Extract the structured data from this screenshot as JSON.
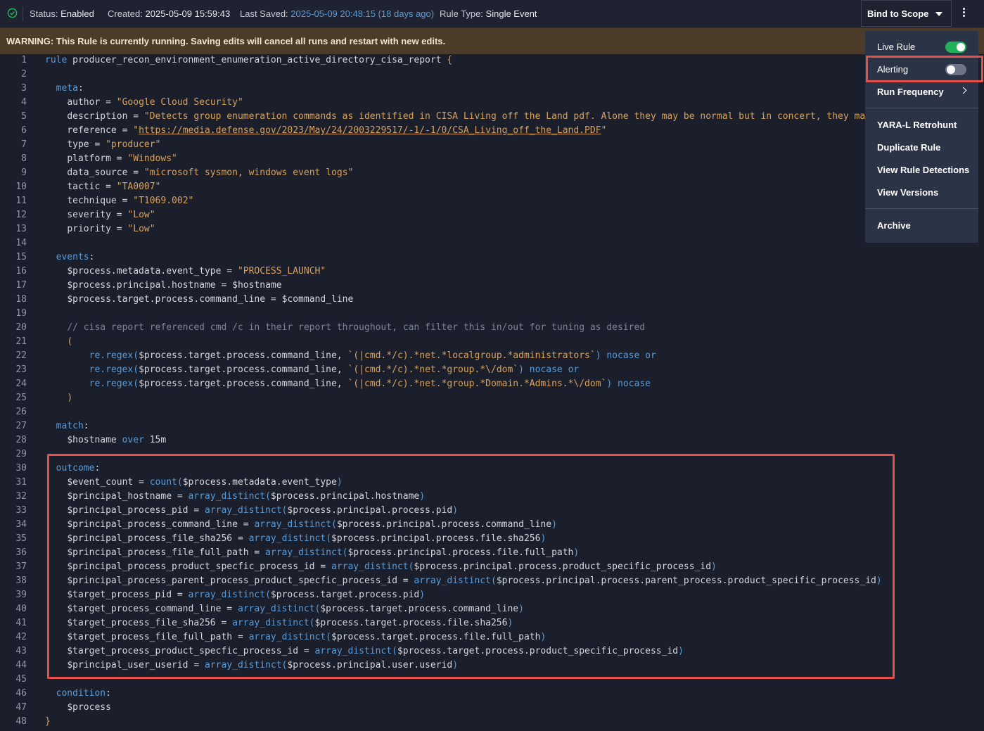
{
  "status_bar": {
    "status_label": "Status:",
    "status_value": "Enabled",
    "created_label": "Created:",
    "created_value": "2025-05-09 15:59:43",
    "saved_label": "Last Saved:",
    "saved_value": "2025-05-09 20:48:15 (18 days ago)",
    "type_label": "Rule Type:",
    "type_value": "Single Event",
    "bind_button": "Bind to Scope"
  },
  "warning": "WARNING: This Rule is currently running. Saving edits will cancel all runs and restart with new edits.",
  "menu": {
    "live_rule": "Live Rule",
    "live_rule_on": true,
    "alerting": "Alerting",
    "alerting_on": false,
    "run_frequency": "Run Frequency",
    "retrohunt": "YARA-L Retrohunt",
    "duplicate": "Duplicate Rule",
    "detections": "View Rule Detections",
    "versions": "View Versions",
    "archive": "Archive"
  },
  "colors": {
    "keyword": "#5b9bd6",
    "string": "#d7a15c",
    "comment": "#7d8596",
    "highlight": "#e4504a",
    "toggle_on": "#20b15a"
  },
  "code": {
    "l1": "producer_recon_environment_enumeration_active_directory_cisa_report",
    "l3": "meta",
    "l4_key": "author",
    "l4_val": "\"Google Cloud Security\"",
    "l5_key": "description",
    "l5_val": "\"Detects group enumeration commands as identified in CISA Living off the Land pdf. Alone they may be normal but in concert, they may",
    "l6_key": "reference",
    "l6_url": "https://media.defense.gov/2023/May/24/2003229517/-1/-1/0/CSA_Living_off_the_Land.PDF",
    "l7_key": "type",
    "l7_val": "\"producer\"",
    "l8_key": "platform",
    "l8_val": "\"Windows\"",
    "l9_key": "data_source",
    "l9_val": "\"microsoft sysmon, windows event logs\"",
    "l10_key": "tactic",
    "l10_val": "\"TA0007\"",
    "l11_key": "technique",
    "l11_val": "\"T1069.002\"",
    "l12_key": "severity",
    "l12_val": "\"Low\"",
    "l13_key": "priority",
    "l13_val": "\"Low\"",
    "l15": "events",
    "l16_a": "$process.metadata.event_type",
    "l16_b": "\"PROCESS_LAUNCH\"",
    "l17_a": "$process.principal.hostname",
    "l17_b": "$hostname",
    "l18_a": "$process.target.process.command_line",
    "l18_b": "$command_line",
    "l20": "// cisa report referenced cmd /c in their report throughout, can filter this in/out for tuning as desired",
    "l22_arg": "$process.target.process.command_line, ",
    "l22_re": "`(|cmd.*/c).*net.*localgroup.*administrators`",
    "l23_re": "`(|cmd.*/c).*net.*group.*\\/dom`",
    "l24_re": "`(|cmd.*/c).*net.*group.*Domain.*Admins.*\\/dom`",
    "l27": "match",
    "l28_a": "$hostname",
    "l28_b": "15m",
    "l30": "outcome",
    "l31_a": "$event_count",
    "l31_b": "$process.metadata.event_type",
    "l32_a": "$principal_hostname",
    "l32_b": "$process.principal.hostname",
    "l33_a": "$principal_process_pid",
    "l33_b": "$process.principal.process.pid",
    "l34_a": "$principal_process_command_line",
    "l34_b": "$process.principal.process.command_line",
    "l35_a": "$principal_process_file_sha256",
    "l35_b": "$process.principal.process.file.sha256",
    "l36_a": "$principal_process_file_full_path",
    "l36_b": "$process.principal.process.file.full_path",
    "l37_a": "$principal_process_product_specfic_process_id",
    "l37_b": "$process.principal.process.product_specific_process_id",
    "l38_a": "$principal_process_parent_process_product_specfic_process_id",
    "l38_b": "$process.principal.process.parent_process.product_specific_process_id",
    "l39_a": "$target_process_pid",
    "l39_b": "$process.target.process.pid",
    "l40_a": "$target_process_command_line",
    "l40_b": "$process.target.process.command_line",
    "l41_a": "$target_process_file_sha256",
    "l41_b": "$process.target.process.file.sha256",
    "l42_a": "$target_process_file_full_path",
    "l42_b": "$process.target.process.file.full_path",
    "l43_a": "$target_process_product_specfic_process_id",
    "l43_b": "$process.target.process.product_specific_process_id",
    "l44_a": "$principal_user_userid",
    "l44_b": "$process.principal.user.userid",
    "l46": "condition",
    "l47": "$process"
  }
}
